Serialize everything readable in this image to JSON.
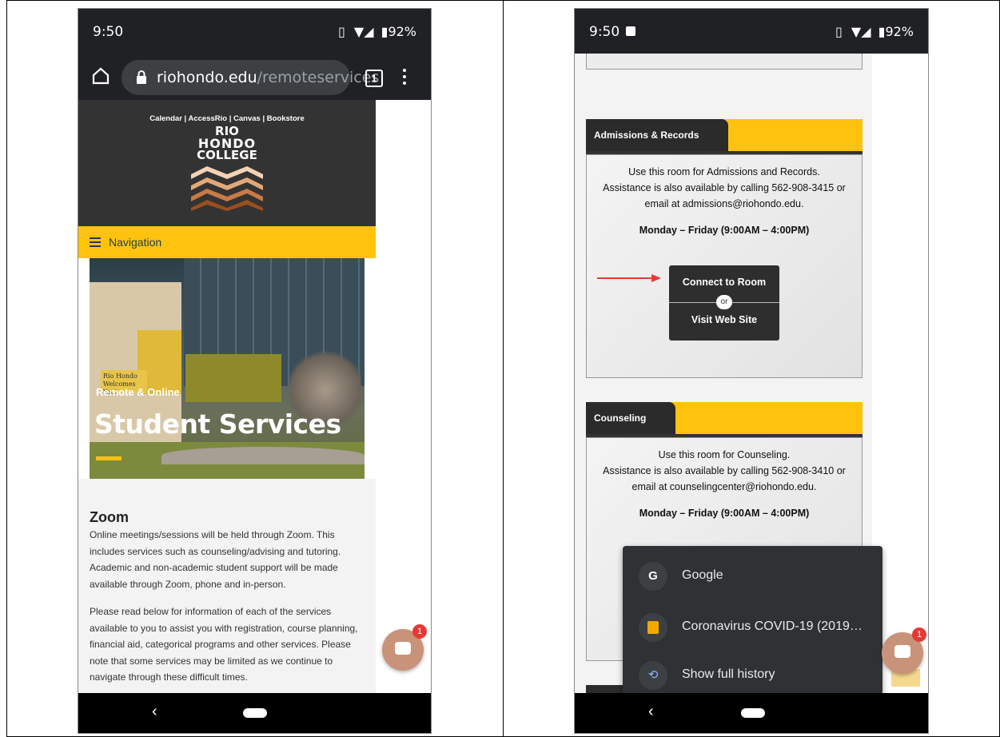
{
  "left": {
    "status": {
      "time": "9:50",
      "battery": "92%"
    },
    "url": {
      "domain": "riohondo.edu",
      "path": "/remoteservices",
      "tab_count": "1"
    },
    "top_links": [
      "Calendar",
      "AccessRio",
      "Canvas",
      "Bookstore"
    ],
    "logo_lines": [
      "RIO",
      "HONDO",
      "COLLEGE"
    ],
    "nav_label": "Navigation",
    "hero": {
      "subtitle": "Remote & Online",
      "title": "Student Services",
      "sign_line1": "Rio Hondo",
      "sign_line2": "Welcomes You!"
    },
    "zoom": {
      "heading": "Zoom",
      "para1": "Online meetings/sessions will be held through Zoom. This includes services such as counseling/advising and tutoring. Academic and non-academic student support will be made available through Zoom, phone and in-person.",
      "para2": "Please read below for information of each of the services available to you to assist you with registration, course planning, financial aid, categorical programs and other services. Please note that some services may be limited as we continue to navigate through these difficult times."
    },
    "chat_badge": "1"
  },
  "right": {
    "status": {
      "time": "9:50",
      "battery": "92%"
    },
    "admissions": {
      "title": "Admissions & Records",
      "line1": "Use this room for Admissions and Records.",
      "line2": "Assistance is also available by calling 562-908-3415 or",
      "line3": "email at admissions@riohondo.edu.",
      "hours": "Monday – Friday (9:00AM – 4:00PM)",
      "connect": "Connect to Room",
      "or": "or",
      "visit": "Visit Web Site"
    },
    "counseling": {
      "title": "Counseling",
      "line1": "Use this room for Counseling.",
      "line2": "Assistance is also available by calling 562-908-3410 or",
      "line3": "email at counselingcenter@riohondo.edu.",
      "hours": "Monday – Friday (9:00AM – 4:00PM)"
    },
    "history_menu": [
      "Google",
      "Coronavirus COVID-19 (2019…",
      "Show full history"
    ],
    "chat_badge": "1"
  },
  "colors": {
    "brand_yellow": "#ffc20e",
    "dark": "#2b2b2b",
    "arrow_red": "#e53935"
  }
}
